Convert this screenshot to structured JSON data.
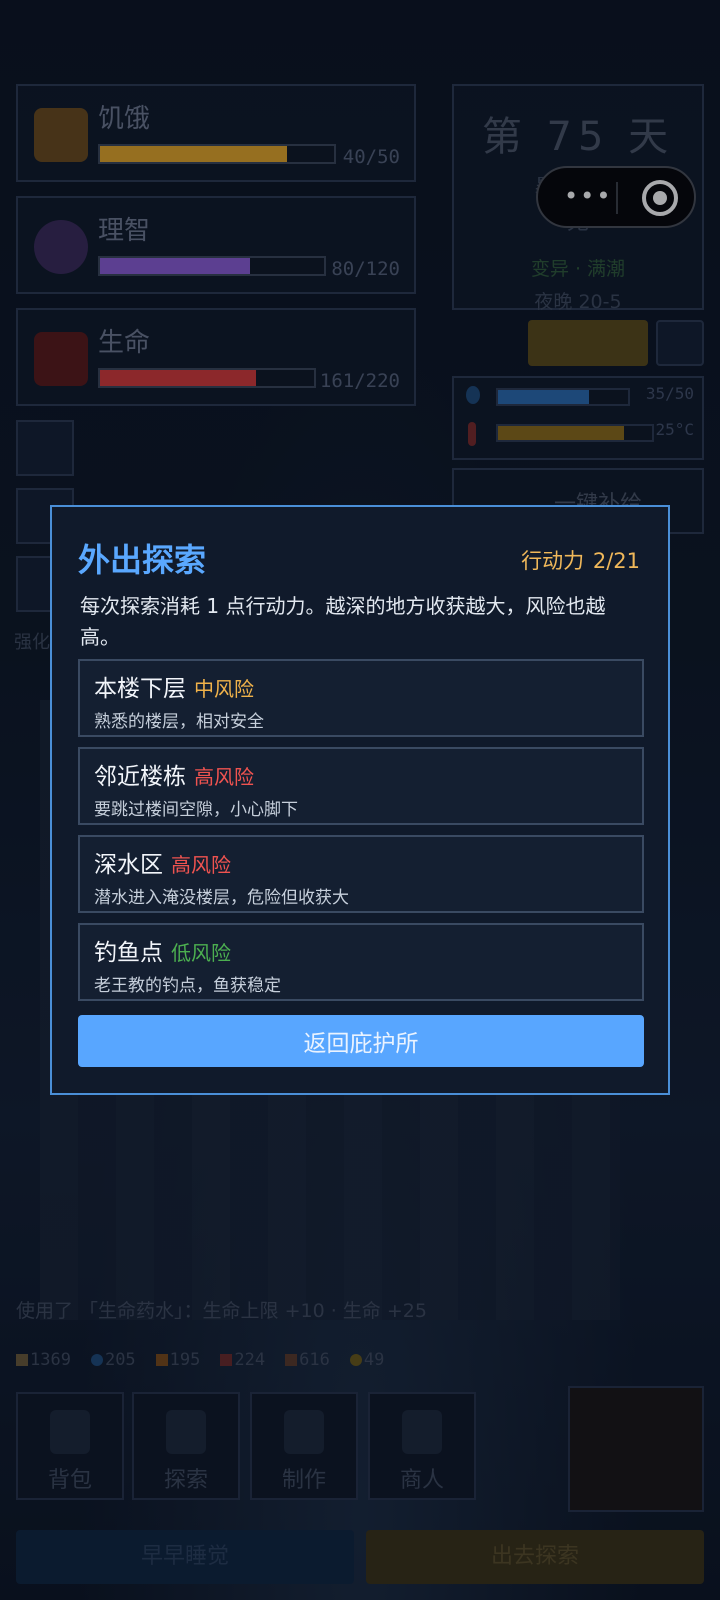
{
  "stats": [
    {
      "label": "饥饿",
      "value": "40/50",
      "fraction": 0.8,
      "color": "#e3a628"
    },
    {
      "label": "理智",
      "value": "80/120",
      "fraction": 0.67,
      "color": "#8a5cd6"
    },
    {
      "label": "生命",
      "value": "161/220",
      "fraction": 0.73,
      "color": "#d43a3a"
    }
  ],
  "day": {
    "title": "第 75 天",
    "weather": "暴雨 · 暗",
    "sub": "无",
    "tags": "变异 · 满潮",
    "time": "夜晚 20-5"
  },
  "resources": {
    "water": {
      "value": "35/50",
      "fraction": 0.7
    },
    "temp": {
      "value": "25°C",
      "fraction": 0.82
    }
  },
  "supply_label": "一键补给",
  "capsule": {
    "menu": "•••"
  },
  "modal": {
    "title": "外出探索",
    "ap_label": "行动力",
    "ap_value": "2/21",
    "description": "每次探索消耗 1 点行动力。越深的地方收获越大，风险也越高。",
    "options": [
      {
        "name": "本楼下层",
        "risk": "中风险",
        "risk_color": "#f0b24a",
        "desc": "熟悉的楼层，相对安全"
      },
      {
        "name": "邻近楼栋",
        "risk": "高风险",
        "risk_color": "#ef5350",
        "desc": "要跳过楼间空隙，小心脚下"
      },
      {
        "name": "深水区",
        "risk": "高风险",
        "risk_color": "#ef5350",
        "desc": "潜水进入淹没楼层，危险但收获大"
      },
      {
        "name": "钓鱼点",
        "risk": "低风险",
        "risk_color": "#4caf50",
        "desc": "老王教的钓点，鱼获稳定"
      }
    ],
    "back_label": "返回庇护所"
  },
  "log": "使用了 「生命药水」：生命上限 +10 · 生命 +25",
  "stock": [
    "1369",
    "205",
    "195",
    "224",
    "616",
    "49"
  ],
  "tabs": [
    "背包",
    "探索",
    "制作",
    "商人"
  ],
  "side_text": "强化",
  "bottom": {
    "left": "早早睡觉",
    "right": "出去探索"
  }
}
